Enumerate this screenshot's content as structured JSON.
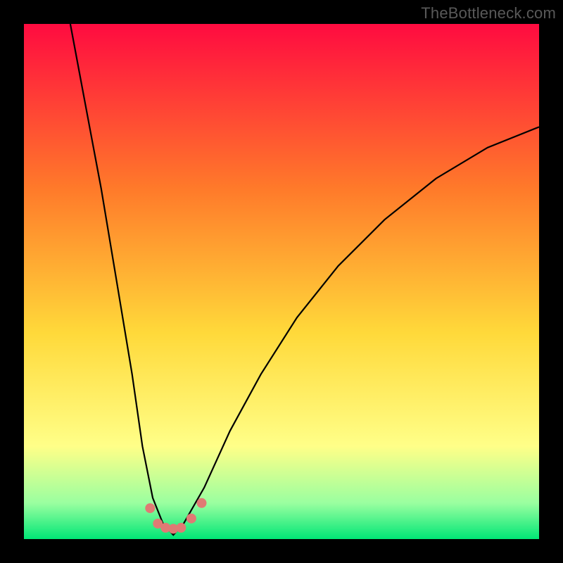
{
  "watermark": "TheBottleneck.com",
  "colors": {
    "frame": "#000000",
    "gradient_top": "#ff0b40",
    "gradient_mid1": "#ff7a2a",
    "gradient_mid2": "#ffd93a",
    "gradient_mid3": "#ffff88",
    "gradient_mid4": "#9affa0",
    "gradient_bottom": "#00e676",
    "curve": "#000000",
    "marker_fill": "#e07a74",
    "marker_stroke": "#c55a54"
  },
  "chart_data": {
    "type": "line",
    "title": "",
    "xlabel": "",
    "ylabel": "",
    "x_range": [
      0,
      100
    ],
    "y_range": [
      0,
      100
    ],
    "curve_left": [
      {
        "x": 9,
        "y": 100
      },
      {
        "x": 12,
        "y": 84
      },
      {
        "x": 15,
        "y": 68
      },
      {
        "x": 18,
        "y": 50
      },
      {
        "x": 21,
        "y": 32
      },
      {
        "x": 23,
        "y": 18
      },
      {
        "x": 25,
        "y": 8
      },
      {
        "x": 27,
        "y": 3
      },
      {
        "x": 29,
        "y": 0.8
      }
    ],
    "curve_right": [
      {
        "x": 29,
        "y": 0.8
      },
      {
        "x": 31,
        "y": 3
      },
      {
        "x": 35,
        "y": 10
      },
      {
        "x": 40,
        "y": 21
      },
      {
        "x": 46,
        "y": 32
      },
      {
        "x": 53,
        "y": 43
      },
      {
        "x": 61,
        "y": 53
      },
      {
        "x": 70,
        "y": 62
      },
      {
        "x": 80,
        "y": 70
      },
      {
        "x": 90,
        "y": 76
      },
      {
        "x": 100,
        "y": 80
      }
    ],
    "markers": [
      {
        "x": 24.5,
        "y": 6
      },
      {
        "x": 26,
        "y": 3
      },
      {
        "x": 27.5,
        "y": 2.2
      },
      {
        "x": 29,
        "y": 2
      },
      {
        "x": 30.5,
        "y": 2.2
      },
      {
        "x": 32.5,
        "y": 4
      },
      {
        "x": 34.5,
        "y": 7
      }
    ]
  }
}
